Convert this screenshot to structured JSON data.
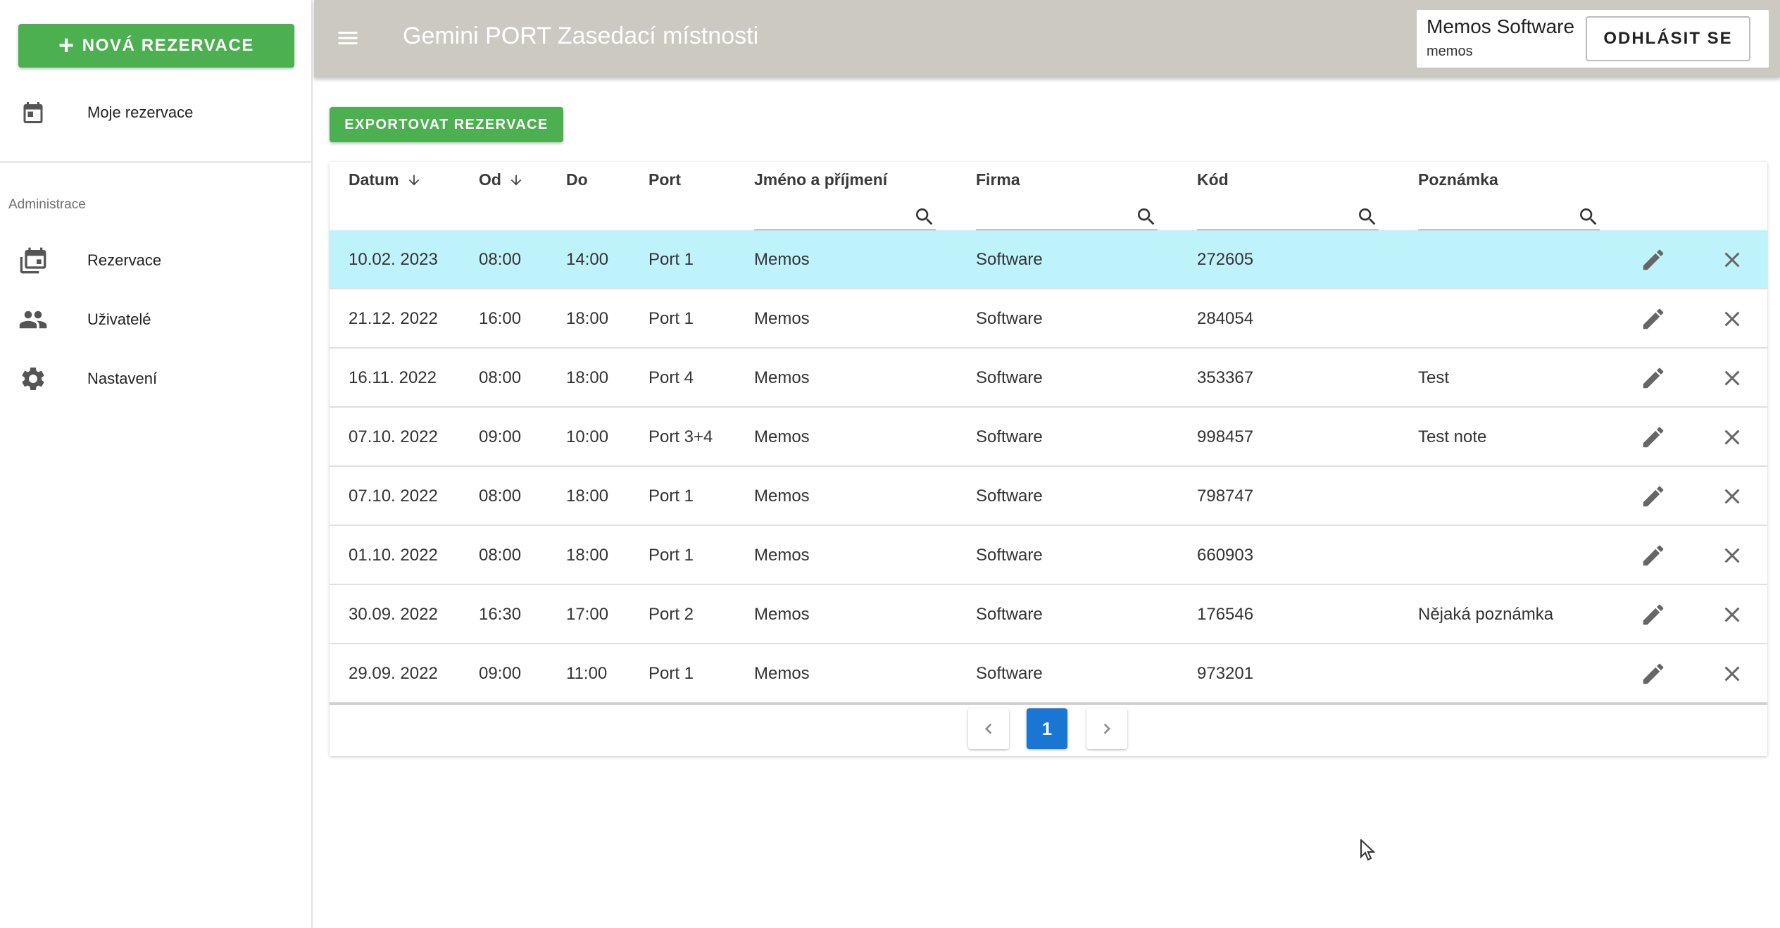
{
  "sidebar": {
    "new_button": "NOVÁ REZERVACE",
    "my_reservations": "Moje rezervace",
    "section_title": "Administrace",
    "items": [
      {
        "label": "Rezervace",
        "icon": "calendar-multiple-icon"
      },
      {
        "label": "Uživatelé",
        "icon": "people-icon"
      },
      {
        "label": "Nastavení",
        "icon": "gear-icon"
      }
    ]
  },
  "header": {
    "title": "Gemini PORT Zasedací místnosti",
    "user_name": "Memos Software",
    "user_login": "memos",
    "logout_label": "ODHLÁSIT SE"
  },
  "main": {
    "export_label": "EXPORTOVAT REZERVACE",
    "columns": [
      "Datum",
      "Od",
      "Do",
      "Port",
      "Jméno a příjmení",
      "Firma",
      "Kód",
      "Poznámka"
    ],
    "filters": {
      "name": "",
      "company": "",
      "code": "",
      "note": ""
    },
    "rows": [
      {
        "date": "10.02. 2023",
        "from": "08:00",
        "to": "14:00",
        "port": "Port 1",
        "name": "Memos",
        "company": "Software",
        "code": "272605",
        "note": ""
      },
      {
        "date": "21.12. 2022",
        "from": "16:00",
        "to": "18:00",
        "port": "Port 1",
        "name": "Memos",
        "company": "Software",
        "code": "284054",
        "note": ""
      },
      {
        "date": "16.11. 2022",
        "from": "08:00",
        "to": "18:00",
        "port": "Port 4",
        "name": "Memos",
        "company": "Software",
        "code": "353367",
        "note": "Test"
      },
      {
        "date": "07.10. 2022",
        "from": "09:00",
        "to": "10:00",
        "port": "Port 3+4",
        "name": "Memos",
        "company": "Software",
        "code": "998457",
        "note": "Test note"
      },
      {
        "date": "07.10. 2022",
        "from": "08:00",
        "to": "18:00",
        "port": "Port 1",
        "name": "Memos",
        "company": "Software",
        "code": "798747",
        "note": ""
      },
      {
        "date": "01.10. 2022",
        "from": "08:00",
        "to": "18:00",
        "port": "Port 1",
        "name": "Memos",
        "company": "Software",
        "code": "660903",
        "note": ""
      },
      {
        "date": "30.09. 2022",
        "from": "16:30",
        "to": "17:00",
        "port": "Port 2",
        "name": "Memos",
        "company": "Software",
        "code": "176546",
        "note": "Nějaká poznámka"
      },
      {
        "date": "29.09. 2022",
        "from": "09:00",
        "to": "11:00",
        "port": "Port 1",
        "name": "Memos",
        "company": "Software",
        "code": "973201",
        "note": ""
      }
    ],
    "pagination": {
      "current_page": "1"
    }
  },
  "colors": {
    "accent_green": "#4caf50",
    "selected_row": "#bff3fc",
    "appbar": "#ccc9c3",
    "page_active": "#1976d2"
  }
}
